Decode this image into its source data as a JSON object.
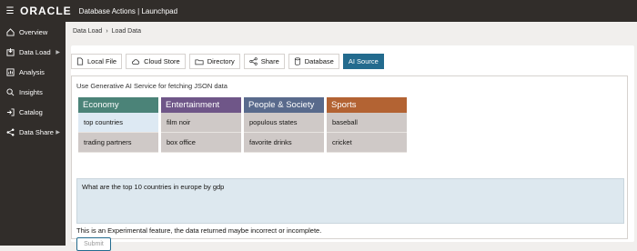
{
  "header": {
    "logo": "ORACLE",
    "app_title": "Database Actions | Launchpad"
  },
  "sidebar": {
    "items": [
      {
        "label": "Overview",
        "icon": "overview-icon"
      },
      {
        "label": "Data Load",
        "icon": "data-load-icon",
        "has_submenu": true
      },
      {
        "label": "Analysis",
        "icon": "analysis-icon"
      },
      {
        "label": "Insights",
        "icon": "insights-icon"
      },
      {
        "label": "Catalog",
        "icon": "catalog-icon"
      },
      {
        "label": "Data Share",
        "icon": "data-share-icon",
        "has_submenu": true
      }
    ]
  },
  "breadcrumb": {
    "parent": "Data Load",
    "separator": "›",
    "current": "Load Data"
  },
  "tabs": [
    {
      "label": "Local File",
      "icon": "file-icon"
    },
    {
      "label": "Cloud Store",
      "icon": "cloud-icon"
    },
    {
      "label": "Directory",
      "icon": "folder-icon"
    },
    {
      "label": "Share",
      "icon": "share-icon"
    },
    {
      "label": "Database",
      "icon": "database-icon"
    },
    {
      "label": "AI Source",
      "icon": "",
      "active": true
    }
  ],
  "panel": {
    "intro": "Use Generative AI Service for fetching JSON data",
    "categories": [
      {
        "title": "Economy",
        "color": "#4b8378",
        "items": [
          "top countries",
          "trading partners"
        ],
        "selected": 0
      },
      {
        "title": "Entertainment",
        "color": "#6f5688",
        "items": [
          "film noir",
          "box office"
        ]
      },
      {
        "title": "People & Society",
        "color": "#596a8c",
        "items": [
          "populous states",
          "favorite drinks"
        ]
      },
      {
        "title": "Sports",
        "color": "#b36333",
        "items": [
          "baseball",
          "cricket"
        ]
      }
    ],
    "query": "What are the top 10 countries in europe by gdp",
    "note": "This is an Experimental feature, the data returned maybe incorrect or incomplete.",
    "submit_label": "Submit"
  },
  "colors": {
    "topbar": "#312d2a",
    "accent": "#236b8e",
    "query_bg": "#dde8ef"
  }
}
